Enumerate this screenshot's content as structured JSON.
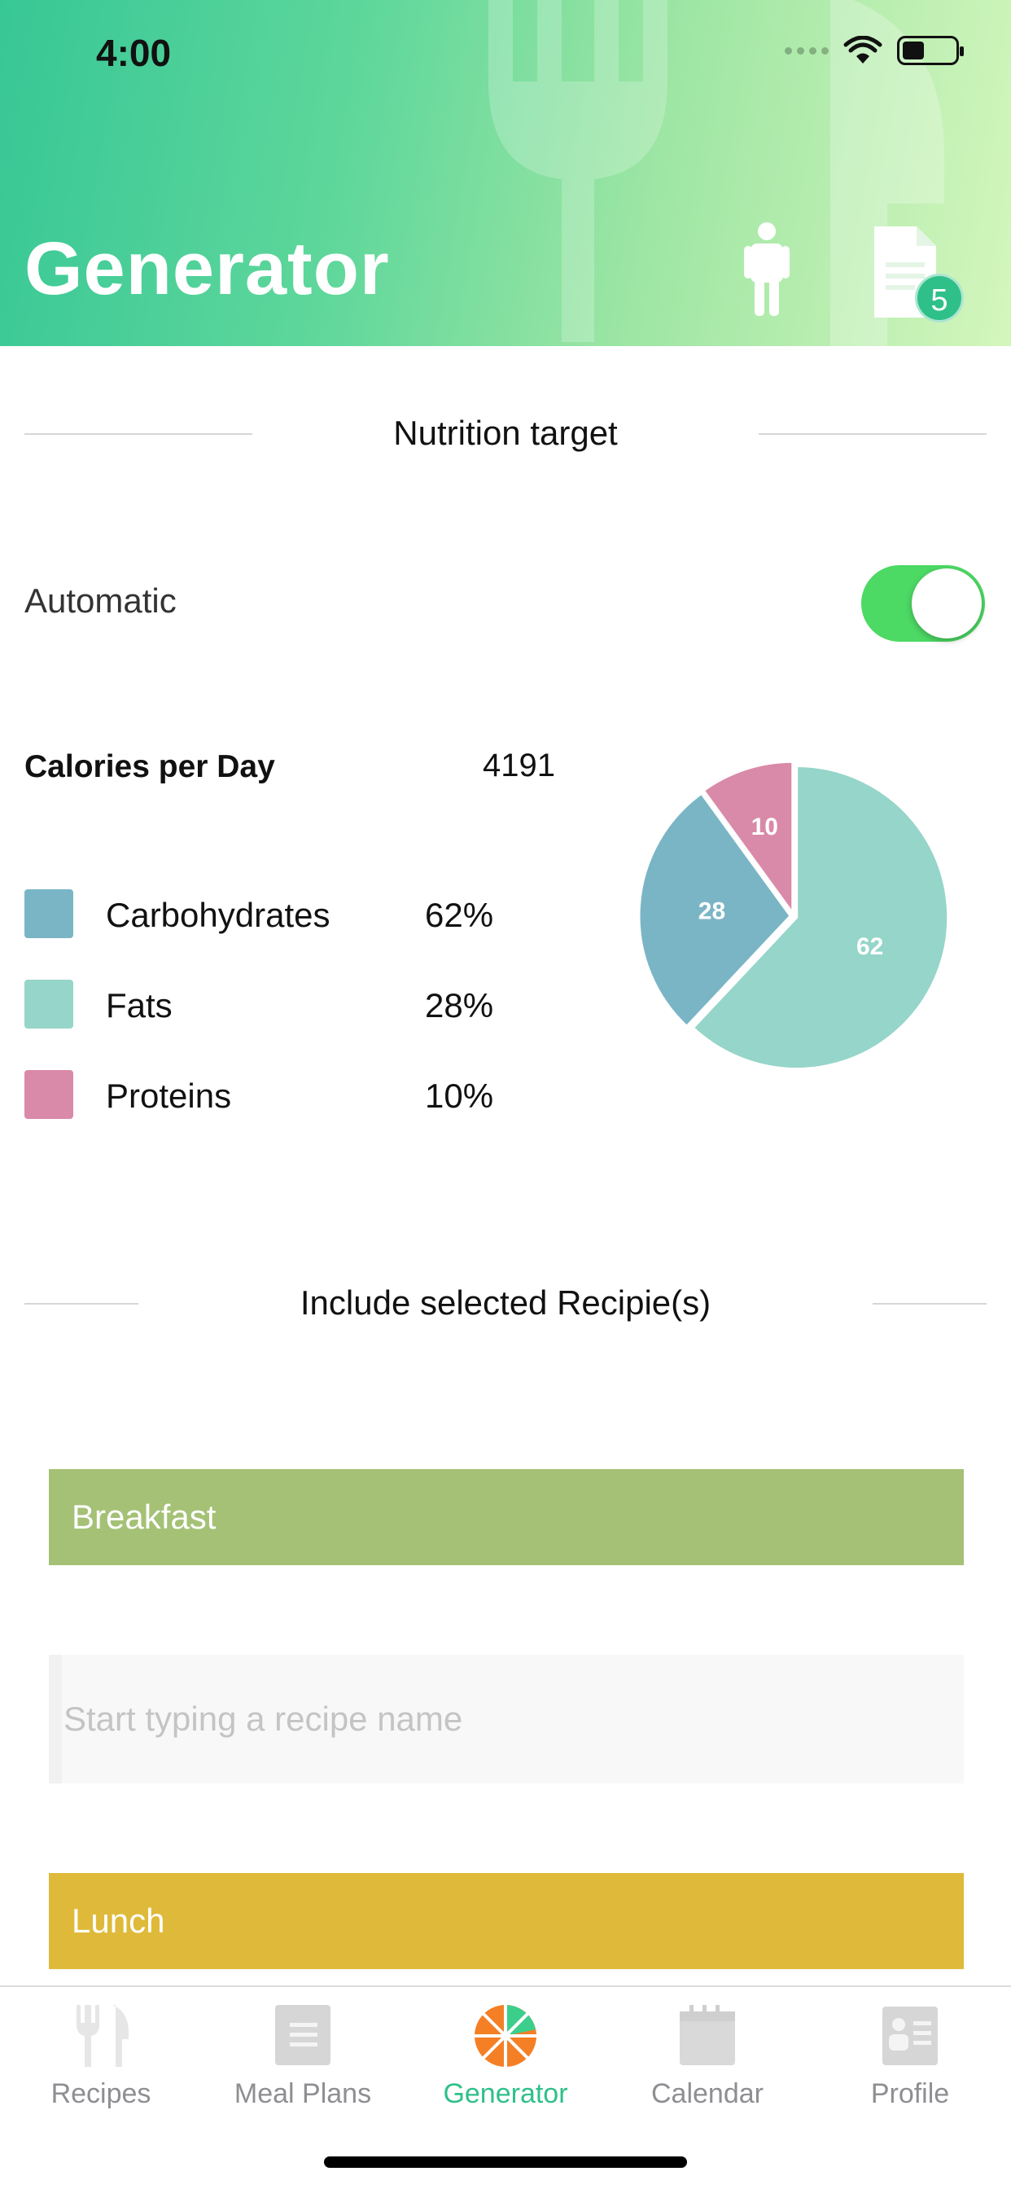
{
  "status_bar": {
    "time": "4:00"
  },
  "header": {
    "title": "Generator",
    "badge_count": "5"
  },
  "nutrition": {
    "section_title": "Nutrition target",
    "automatic_label": "Automatic",
    "automatic_on": true,
    "calories_label": "Calories per Day",
    "calories_value": "4191",
    "macros": [
      {
        "name": "Carbohydrates",
        "percent": "62%",
        "color": "#7ab5c6"
      },
      {
        "name": "Fats",
        "percent": "28%",
        "color": "#96d5c9"
      },
      {
        "name": "Proteins",
        "percent": "10%",
        "color": "#d98aa8"
      }
    ]
  },
  "chart_data": {
    "type": "pie",
    "slices": [
      {
        "label": "62",
        "value": 62,
        "color": "#96d5c9"
      },
      {
        "label": "28",
        "value": 28,
        "color": "#7ab5c6"
      },
      {
        "label": "10",
        "value": 10,
        "color": "#d98aa8"
      }
    ]
  },
  "recipes": {
    "section_title": "Include selected Recipie(s)",
    "breakfast_label": "Breakfast",
    "breakfast_color": "#a4c176",
    "search_placeholder": "Start typing a recipe name",
    "lunch_label": "Lunch",
    "lunch_color": "#dfba3a"
  },
  "tabs": [
    {
      "label": "Recipes",
      "icon": "fork-knife-icon",
      "active": false
    },
    {
      "label": "Meal Plans",
      "icon": "book-icon",
      "active": false
    },
    {
      "label": "Generator",
      "icon": "orange-slice-icon",
      "active": true
    },
    {
      "label": "Calendar",
      "icon": "calendar-icon",
      "active": false
    },
    {
      "label": "Profile",
      "icon": "profile-card-icon",
      "active": false
    }
  ],
  "colors": {
    "accent": "#2fc08a",
    "toggle_on": "#4cd964"
  }
}
